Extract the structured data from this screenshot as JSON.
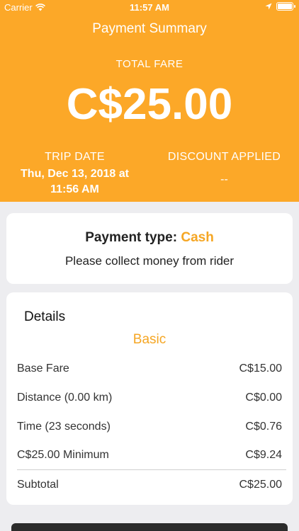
{
  "status_bar": {
    "carrier": "Carrier",
    "time": "11:57 AM"
  },
  "header": {
    "title": "Payment Summary",
    "total_label": "TOTAL FARE",
    "total_amount": "C$25.00",
    "trip_date_label": "TRIP DATE",
    "trip_date_value": "Thu, Dec 13, 2018 at 11:56 AM",
    "discount_label": "DISCOUNT APPLIED",
    "discount_value": "--"
  },
  "payment": {
    "type_label": "Payment type:",
    "type_value": "Cash",
    "message": "Please collect money from rider"
  },
  "details": {
    "title": "Details",
    "tier": "Basic",
    "rows": [
      {
        "label": "Base Fare",
        "value": "C$15.00"
      },
      {
        "label": "Distance (0.00 km)",
        "value": "C$0.00"
      },
      {
        "label": "Time (23 seconds)",
        "value": "C$0.76"
      },
      {
        "label": "C$25.00 Minimum",
        "value": "C$9.24"
      }
    ],
    "subtotal_label": "Subtotal",
    "subtotal_value": "C$25.00"
  }
}
